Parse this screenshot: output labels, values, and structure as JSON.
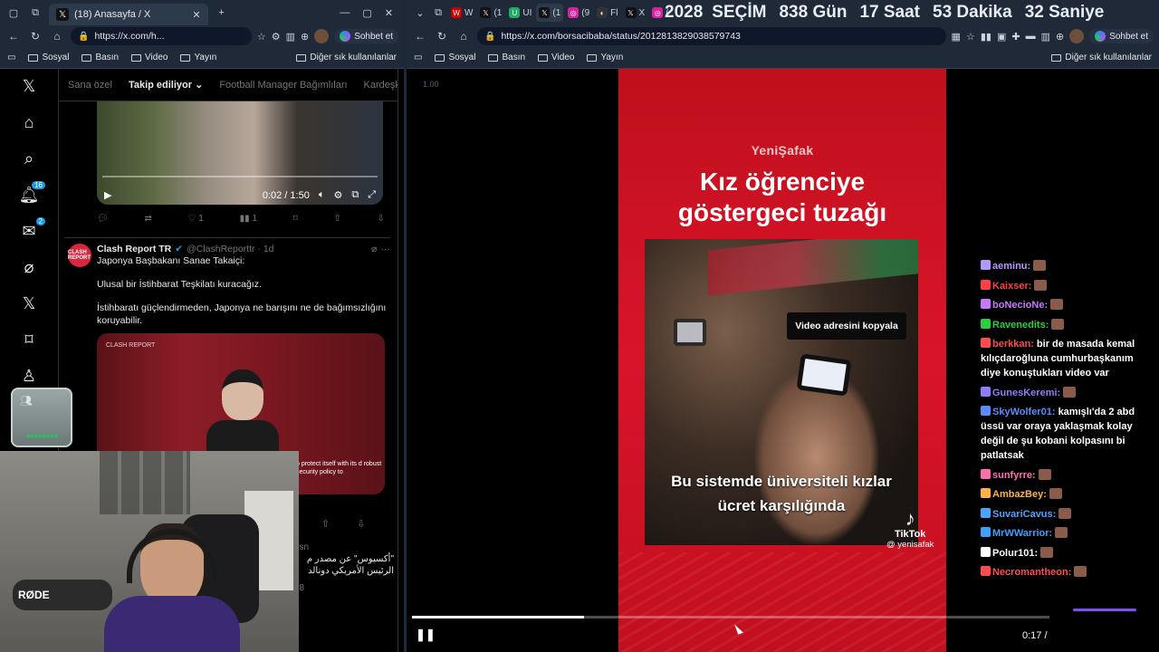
{
  "left": {
    "tab_title": "(18) Anasayfa / X",
    "url": "https://x.com/h...",
    "chat_button": "Sohbet et",
    "bookmarks": [
      "Sosyal",
      "Basın",
      "Video",
      "Yayın"
    ],
    "bookmarks_other": "Diğer sık kullanılanlar",
    "nav_badges": {
      "notifications": "16",
      "messages": "2"
    },
    "feed_tabs": [
      "Sana özel",
      "Takip ediliyor",
      "Football Manager Bağımlıları",
      "Kardeşk"
    ],
    "video1": {
      "time": "0:02 / 1:50"
    },
    "tweet1_actions": {
      "likes": "1",
      "views": "1"
    },
    "tweet2": {
      "name": "Clash Report TR",
      "handle": "@ClashReporttr · 1d",
      "avatar_text": "CLASH REPORT",
      "lines": [
        "Japonya Başbakanı Sanae Takaiçi:",
        "Ulusal bir İstihbarat Teşkilatı kuracağız.",
        "İstihbaratı güçlendirmeden, Japonya ne barışını ne de bağımsızlığını koruyabilir."
      ],
      "image_watermark": "CLASH REPORT",
      "image_subtitle": "o protect itself with its d robust security policy to"
    },
    "tweet3": {
      "handle_time": "9sn",
      "text": "\"أكسيوس\" عن مصدر م\nالرئيس الأمريكي دونالد",
      "views": "98"
    },
    "webcam_mic_label": "RØDE"
  },
  "right": {
    "countdown": [
      "2028",
      "SEÇİM",
      "838 Gün",
      "17 Saat",
      "53 Dakika",
      "32 Saniye"
    ],
    "url": "https://x.com/borsacibaba/status/2012813829038579743",
    "chat_button": "Sohbet et",
    "bookmarks": [
      "Sosyal",
      "Basın",
      "Video",
      "Yayın"
    ],
    "bookmarks_other": "Diğer sık kullanılanlar",
    "speed_label": "1.00",
    "video": {
      "brand": "YeniŞafak",
      "headline_1": "Kız öğrenciye",
      "headline_2": "göstergeci tuzağı",
      "caption_1": "Bu sistemde üniversiteli kızlar",
      "caption_2": "ücret karşılığında",
      "copy_button": "Video adresini kopyala",
      "tiktok": "TikTok",
      "tiktok_handle": "@ yenisafak",
      "time": "0:17 /",
      "progress": 0.27
    },
    "chat": [
      {
        "user": "aeminu:",
        "color": "#b497ff",
        "text": ""
      },
      {
        "user": "Kaixser:",
        "color": "#ff4040",
        "text": ""
      },
      {
        "user": "boNecioNe:",
        "color": "#c678ff",
        "text": ""
      },
      {
        "user": "Ravenedits:",
        "color": "#2ecc40",
        "text": ""
      },
      {
        "user": "berkkan:",
        "color": "#ff4d4d",
        "text": "bir de masada kemal kılıçdaroğluna cumhurbaşkanım diye konuştukları video var"
      },
      {
        "user": "GunesKeremi:",
        "color": "#8c7cff",
        "text": ""
      },
      {
        "user": "SkyWolfer01:",
        "color": "#5b8cff",
        "text": "kamışlı'da 2 abd üssü var oraya yaklaşmak kolay değil de şu kobani kolpasını bi patlatsak"
      },
      {
        "user": "sunfyrre:",
        "color": "#ff6fb0",
        "text": ""
      },
      {
        "user": "AmbazBey:",
        "color": "#ffb347",
        "text": ""
      },
      {
        "user": "SuvariCavus:",
        "color": "#4da3ff",
        "text": ""
      },
      {
        "user": "MrWWarrior:",
        "color": "#3da0ff",
        "text": ""
      },
      {
        "user": "Polur101:",
        "color": "#ffffff",
        "text": ""
      },
      {
        "user": "Necromantheon:",
        "color": "#ff4d4d",
        "text": ""
      }
    ]
  }
}
